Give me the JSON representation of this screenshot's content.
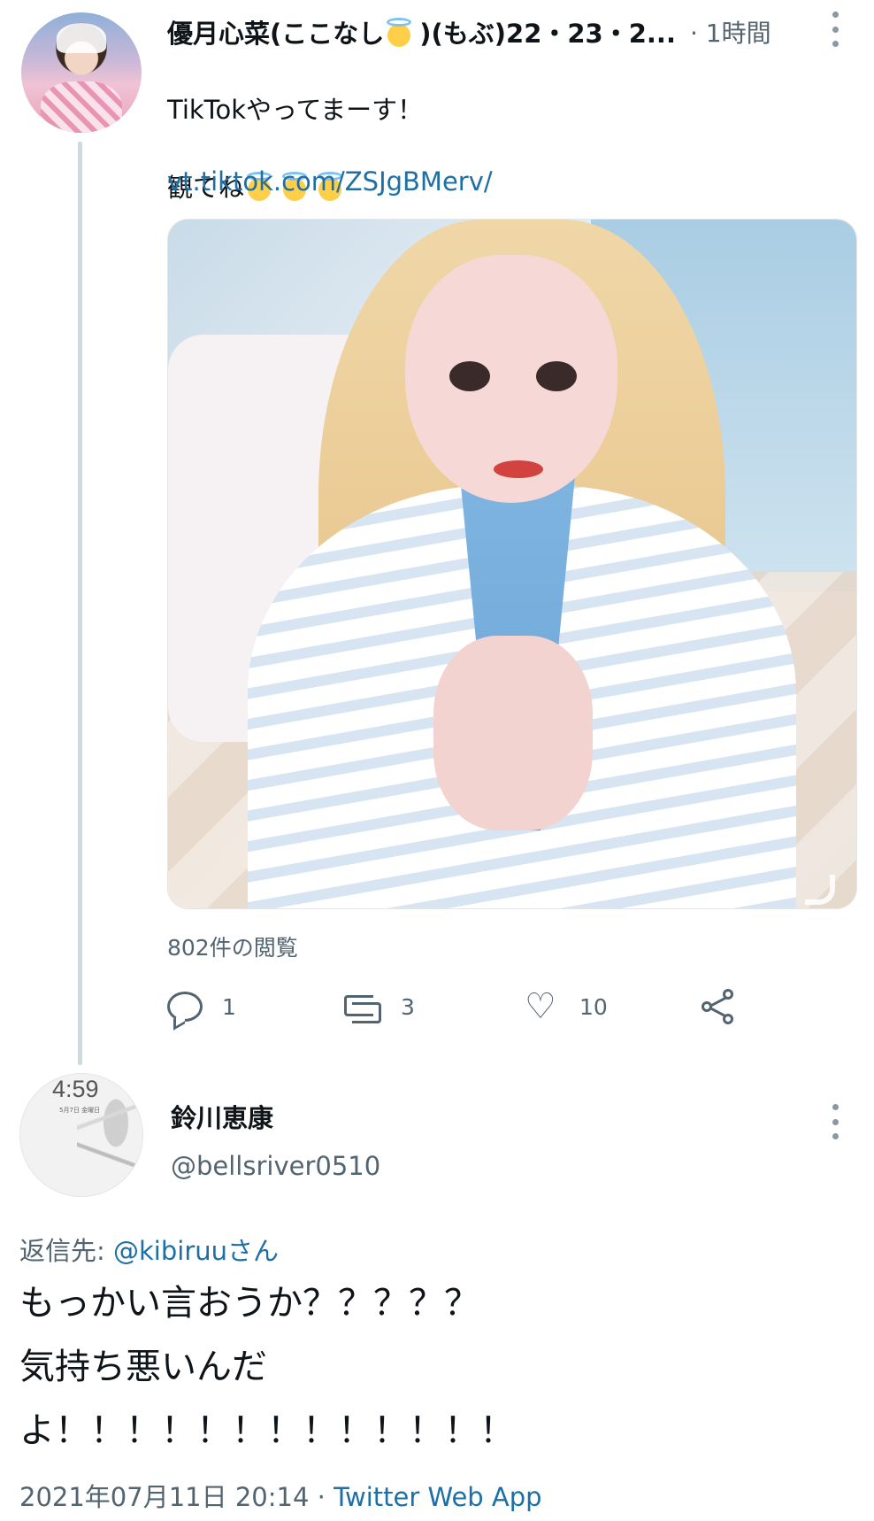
{
  "tweet1": {
    "display_name": "優月心菜(ここなし",
    "display_name_suffix": ")(もぶ)22・23・2...",
    "time": "· 1時間",
    "text_line1": "TikTokやってまーす！",
    "text_line2": "観てね",
    "link": "vt.tiktok.com/ZSJgBMerv/",
    "views": "802件の閲覧",
    "reply_count": "1",
    "retweet_count": "3",
    "like_count": "10",
    "icons": {
      "reply": "reply-icon",
      "retweet": "retweet-icon",
      "like": "heart-icon",
      "share": "share-icon",
      "more": "more-icon"
    }
  },
  "tweet2": {
    "display_name": "鈴川恵康",
    "handle": "@bellsriver0510",
    "avatar_clock": "4:59",
    "avatar_date": "5月7日 金曜日",
    "reply_prefix": "返信先: ",
    "reply_mention": "@kibiruuさん",
    "body": "もっかい言おうか？？？？？\n気持ち悪いんだ\nよ！！！！！！！！！！！！！",
    "timestamp": "2021年07月11日 20:14 · ",
    "app": "Twitter Web App"
  },
  "colors": {
    "link": "#1d6fa5",
    "secondary": "#536471",
    "thread_line": "#cfd9de"
  }
}
